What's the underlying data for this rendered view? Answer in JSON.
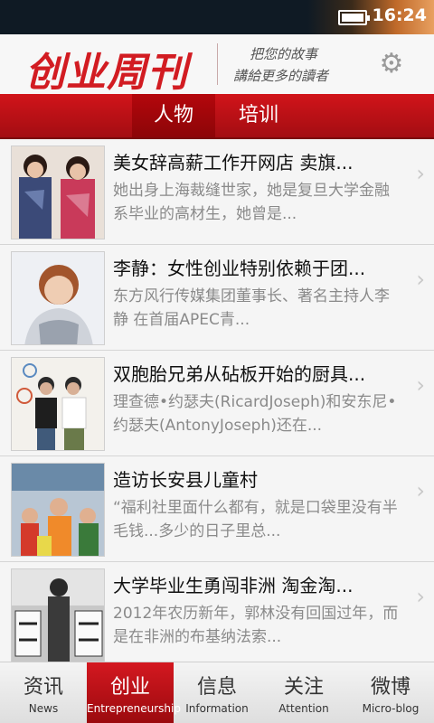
{
  "status_bar": {
    "time": "16:24",
    "battery_icon": "battery-icon"
  },
  "header": {
    "logo_text": "创业周刊",
    "slogan_line1": "把您的故事",
    "slogan_line2": "講給更多的讀者",
    "settings_icon": "gear-icon"
  },
  "tabs": [
    {
      "label": "人物",
      "active": true
    },
    {
      "label": "培训",
      "active": false
    }
  ],
  "articles": [
    {
      "title": "美女辞高薪工作开网店 卖旗...",
      "summary": "    她出身上海裁缝世家，她是复旦大学金融系毕业的高材生，她曾是..."
    },
    {
      "title": "李静：女性创业特别依赖于团...",
      "summary": "    东方风行传媒集团董事长、著名主持人李静        在首届APEC青..."
    },
    {
      "title": "双胞胎兄弟从砧板开始的厨具...",
      "summary": "    理查德•约瑟夫(RicardJoseph)和安东尼•约瑟夫(AntonyJoseph)还在..."
    },
    {
      "title": "造访长安县儿童村",
      "summary": "    “福利社里面什么都有，就是口袋里没有半毛钱...多少的日子里总..."
    },
    {
      "title": "大学毕业生勇闯非洲 淘金淘...",
      "summary": "    2012年农历新年，郭林没有回国过年，而是在非洲的布基纳法索..."
    }
  ],
  "bottom_nav": [
    {
      "zh": "资讯",
      "en": "News",
      "active": false
    },
    {
      "zh": "创业",
      "en": "Entrepreneurship",
      "active": true
    },
    {
      "zh": "信息",
      "en": "Information",
      "active": false
    },
    {
      "zh": "关注",
      "en": "Attention",
      "active": false
    },
    {
      "zh": "微博",
      "en": "Micro-blog",
      "active": false
    }
  ],
  "colors": {
    "brand_red": "#d21c22",
    "tab_bar": "#c1121a"
  }
}
